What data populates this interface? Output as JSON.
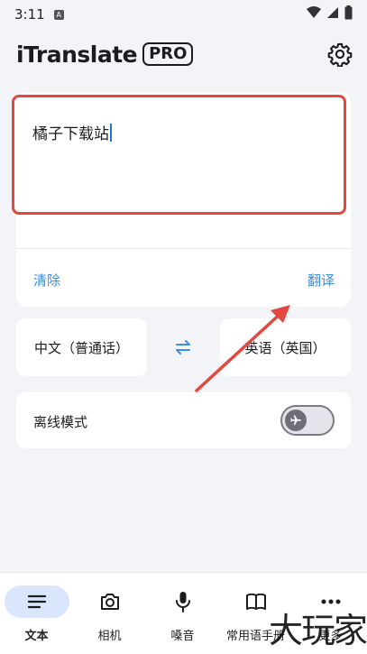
{
  "status": {
    "time": "3:11",
    "badge": "A"
  },
  "header": {
    "title": "iTranslate",
    "badge": "PRO"
  },
  "input": {
    "text": "橘子下载站"
  },
  "actions": {
    "clear": "清除",
    "translate": "翻译"
  },
  "languages": {
    "source": "中文（普通话）",
    "target": "英语（英国）"
  },
  "offline": {
    "label": "离线模式",
    "enabled": false
  },
  "nav": {
    "items": [
      {
        "label": "文本",
        "icon": "text-lines-icon",
        "active": true
      },
      {
        "label": "相机",
        "icon": "camera-icon",
        "active": false
      },
      {
        "label": "嗓音",
        "icon": "microphone-icon",
        "active": false
      },
      {
        "label": "常用语手册",
        "icon": "phrasebook-icon",
        "active": false
      },
      {
        "label": "更多",
        "icon": "more-dots-icon",
        "active": false
      }
    ]
  },
  "watermark": "大玩家",
  "colors": {
    "accent": "#3b8fe0",
    "highlight_border": "#e4473e",
    "annotation_arrow": "#e4473e",
    "nav_active_bg": "#d9e6fb"
  }
}
